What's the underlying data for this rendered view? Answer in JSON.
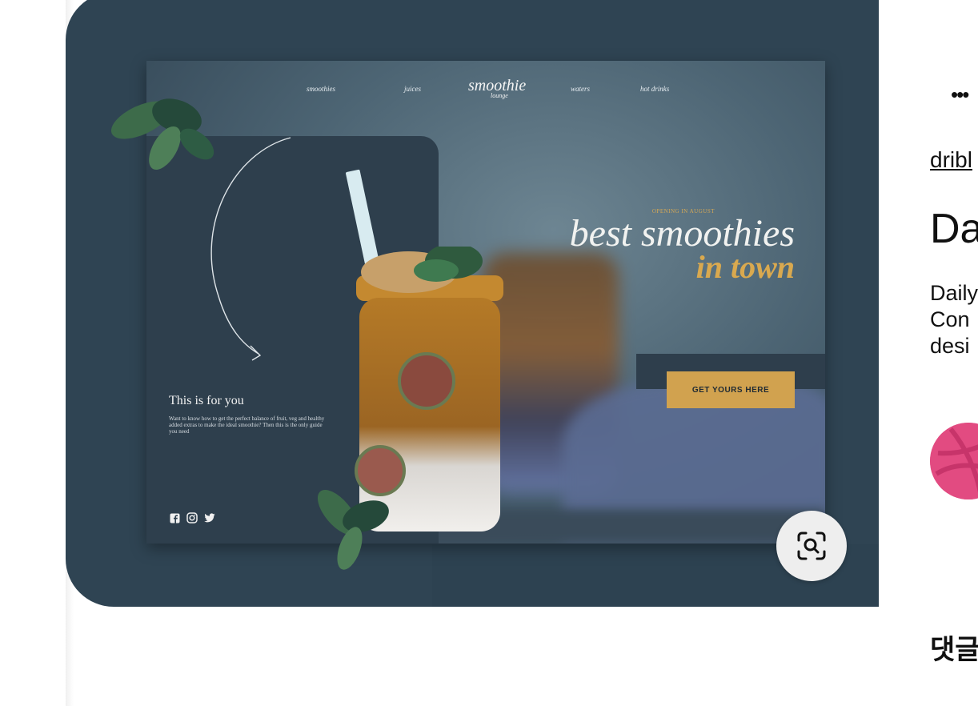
{
  "pin": {
    "nav": {
      "smoothies": "smoothies",
      "juices": "juices",
      "logo": "smoothie",
      "logo_sub": "lounge",
      "waters": "waters",
      "hot_drinks": "hot drinks"
    },
    "panel": {
      "heading": "This is for you",
      "body": "Want to know how to get the perfect balance of fruit, veg and healthy added extras to make the ideal smoothie? Then this is the only guide you need"
    },
    "hero": {
      "eyebrow": "OPENING IN AUGUST",
      "line1": "best smoothies",
      "line2": "in town"
    },
    "cta_label": "GET YOURS HERE",
    "socials": [
      "facebook-icon",
      "instagram-icon",
      "twitter-icon"
    ],
    "colors": {
      "card": "#2f4453",
      "accent": "#d1a24f"
    }
  },
  "zoom_button_icon": "visual-search-icon",
  "sidebar": {
    "more_label": "•••",
    "source_link": "dribl",
    "title": "Da",
    "description_lines": [
      "Daily",
      "Con",
      "desi"
    ],
    "avatar_icon": "dribbble-icon",
    "comments_heading": "댓글"
  }
}
